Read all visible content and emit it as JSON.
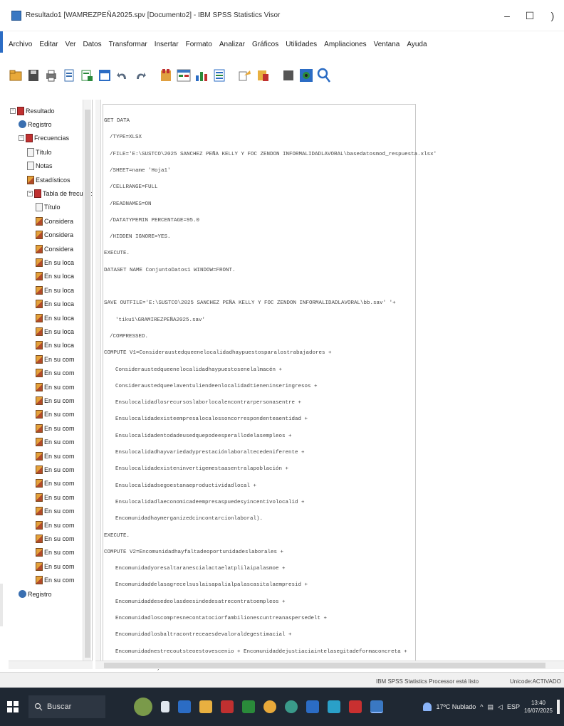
{
  "window": {
    "title": "Resultado1 [WAMREZPEÑA2025.spv [Documento2] - IBM SPSS Statistics Visor",
    "minimize": "–",
    "maximize": "☐",
    "close": ")"
  },
  "menu": [
    "Archivo",
    "Editar",
    "Ver",
    "Datos",
    "Transformar",
    "Insertar",
    "Formato",
    "Analizar",
    "Gráficos",
    "Utilidades",
    "Ampliaciones",
    "Ventana",
    "Ayuda"
  ],
  "toolbar_icons": [
    "open-folder-icon",
    "save-icon",
    "print-icon",
    "export-icon",
    "recall-dialog-icon",
    "goto-data-icon",
    "undo-icon",
    "redo-icon",
    "goto-case-icon",
    "variables-icon",
    "chart-icon",
    "show-output-icon",
    "designate-window-icon",
    "insert-output-icon",
    "hide-icon",
    "select-icon",
    "search-icon"
  ],
  "outline": {
    "items": [
      {
        "label": "Resultado",
        "icon": "book",
        "level": 0,
        "expander": "−"
      },
      {
        "label": "Registro",
        "icon": "log",
        "level": 1
      },
      {
        "label": "Frecuencias",
        "icon": "book",
        "level": 1,
        "expander": "−"
      },
      {
        "label": "Título",
        "icon": "doc",
        "level": 2
      },
      {
        "label": "Notas",
        "icon": "doc",
        "level": 2
      },
      {
        "label": "Estadísticos",
        "icon": "table",
        "level": 2
      },
      {
        "label": "Tabla de frecuencias",
        "icon": "book",
        "level": 2,
        "expander": "−"
      },
      {
        "label": "Título",
        "icon": "doc",
        "level": 3
      },
      {
        "label": "Considera",
        "icon": "table",
        "level": 3
      },
      {
        "label": "Considera",
        "icon": "table",
        "level": 3
      },
      {
        "label": "Considera",
        "icon": "table",
        "level": 3
      },
      {
        "label": "En su loca",
        "icon": "table",
        "level": 3
      },
      {
        "label": "En su loca",
        "icon": "table",
        "level": 3
      },
      {
        "label": "En su loca",
        "icon": "table",
        "level": 3
      },
      {
        "label": "En su loca",
        "icon": "table",
        "level": 3
      },
      {
        "label": "En su loca",
        "icon": "table",
        "level": 3
      },
      {
        "label": "En su loca",
        "icon": "table",
        "level": 3
      },
      {
        "label": "En su loca",
        "icon": "table",
        "level": 3
      },
      {
        "label": "En su com",
        "icon": "table",
        "level": 3
      },
      {
        "label": "En su com",
        "icon": "table",
        "level": 3
      },
      {
        "label": "En su com",
        "icon": "table",
        "level": 3
      },
      {
        "label": "En su com",
        "icon": "table",
        "level": 3
      },
      {
        "label": "En su com",
        "icon": "table",
        "level": 3
      },
      {
        "label": "En su com",
        "icon": "table",
        "level": 3
      },
      {
        "label": "En su com",
        "icon": "table",
        "level": 3
      },
      {
        "label": "En su com",
        "icon": "table",
        "level": 3
      },
      {
        "label": "En su com",
        "icon": "table",
        "level": 3
      },
      {
        "label": "En su com",
        "icon": "table",
        "level": 3
      },
      {
        "label": "En su com",
        "icon": "table",
        "level": 3
      },
      {
        "label": "En su com",
        "icon": "table",
        "level": 3
      },
      {
        "label": "En su com",
        "icon": "table",
        "level": 3
      },
      {
        "label": "En su com",
        "icon": "table",
        "level": 3
      },
      {
        "label": "En su com",
        "icon": "table",
        "level": 3
      },
      {
        "label": "En su com",
        "icon": "table",
        "level": 3
      },
      {
        "label": "En su com",
        "icon": "table",
        "level": 3
      },
      {
        "label": "Registro",
        "icon": "log",
        "level": 1
      }
    ]
  },
  "syntax": [
    {
      "text": "GET DATA",
      "indent": 0
    },
    {
      "text": "/TYPE=XLSX",
      "indent": 1
    },
    {
      "text": "/FILE='E:\\SUSTCO\\2025 SANCHEZ PEÑA KELLY Y FOC ZENDON INFORMALIDADLAVORAL\\basedatosmod_respuesta.xlsx'",
      "indent": 1
    },
    {
      "text": "/SHEET=name 'Hoja1'",
      "indent": 1
    },
    {
      "text": "/CELLRANGE=FULL",
      "indent": 1
    },
    {
      "text": "/READNAMES=ON",
      "indent": 1
    },
    {
      "text": "/DATATYPEMIN PERCENTAGE=95.0",
      "indent": 1
    },
    {
      "text": "/HIDDEN IGNORE=YES.",
      "indent": 1
    },
    {
      "text": "EXECUTE.",
      "indent": 0
    },
    {
      "text": "DATASET NAME ConjuntoDatos1 WINDOW=FRONT.",
      "indent": 0
    },
    {
      "text": "",
      "indent": 0
    },
    {
      "text": "SAVE OUTFILE='E:\\SUSTCO\\2025 SANCHEZ PEÑA KELLY Y FOC ZENDON INFORMALIDADLAVORAL\\bb.sav' '+",
      "indent": 0
    },
    {
      "text": "'tiku1\\GRAMIREZPEÑA2025.sav'",
      "indent": 2
    },
    {
      "text": "/COMPRESSED.",
      "indent": 1
    },
    {
      "text": "COMPUTE V1=Consideraustedqueenelocalidadhaypuestosparalostrabajadores +",
      "indent": 0
    },
    {
      "text": "Consideraustedqueenelocalidadhaypuestosenelalmacén +",
      "indent": 2
    },
    {
      "text": "Consideraustedqueelaventuliendeenlocalidadtieneninseringresos +",
      "indent": 2
    },
    {
      "text": "Ensulocalidadlosrecursoslaborlocalencontrarpersonasentre +",
      "indent": 2
    },
    {
      "text": "Ensulocalidadexisteempresalocalossoncorrespondenteaentidad +",
      "indent": 2
    },
    {
      "text": "Ensulocalidadentodadeusedquepodeesperallodelasempleos +",
      "indent": 2
    },
    {
      "text": "Ensulocalidadhayvariedadyprestaciónlaboraltecedeniferente +",
      "indent": 2
    },
    {
      "text": "Ensulocalidadexisteninvertigemestaasentralapoblación +",
      "indent": 2
    },
    {
      "text": "Ensulocalidadsegoestanaeproductividadlocal +",
      "indent": 2
    },
    {
      "text": "Ensulocalidadlaeconomicadeempresaspuedesyincentivolocalid +",
      "indent": 2
    },
    {
      "text": "Encomunidadhaymerganizedcincontarcionlaboral).",
      "indent": 2
    },
    {
      "text": "EXECUTE.",
      "indent": 0
    },
    {
      "text": "COMPUTE V2=Encomunidadhayfaltadeoportunidadeslaborales +",
      "indent": 0
    },
    {
      "text": "Encomunidadyoresaltaranescialactaelatplilaipalasmoe +",
      "indent": 2
    },
    {
      "text": "Encomunidaddelasagrecelsuslaisapalialpalascasitalaempresid +",
      "indent": 2
    },
    {
      "text": "Encomunidaddesedeolasdeesindedesatrecontratoempleos +",
      "indent": 2
    },
    {
      "text": "Encomunidadloscompresnecontatociorfambilionescuntreanaspersedelt +",
      "indent": 2
    },
    {
      "text": "Encomunidadlosbaltracontreceaesdevaloraldegestimacial +",
      "indent": 2
    },
    {
      "text": "Encomunidadnestrecoutsteoestovescenio + Encomunidaddejustiaciaintelasegitadeformaconcreta +",
      "indent": 2
    },
    {
      "text": "Encomunidadhaydeatcuertiradedeletiria +",
      "indent": 2
    }
  ],
  "status": {
    "processor": "IBM SPSS Statistics Processor está listo",
    "unicode": "Unicode:ACTIVADO"
  },
  "taskbar": {
    "search_placeholder": "Buscar",
    "weather": "17ºC Nublado",
    "time": "13:40",
    "date": "16/07/2025",
    "lang": "ESP"
  },
  "colors": {
    "accent": "#2b6cc4",
    "taskbar": "#1f2833"
  }
}
